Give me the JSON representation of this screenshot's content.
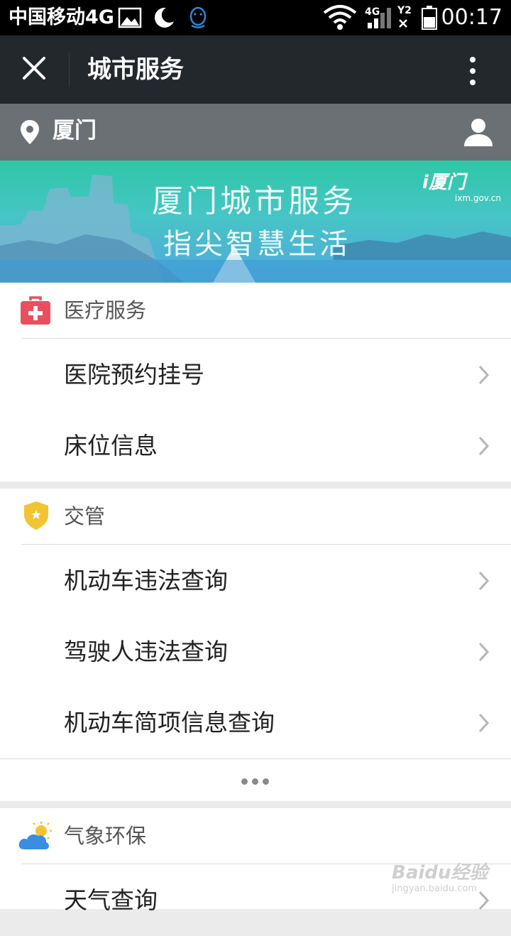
{
  "status_bar": {
    "carrier": "中国移动4G",
    "net_label": "4G",
    "sim_label": "Y2",
    "time": "00:17",
    "icons": [
      "image-icon",
      "moon-icon",
      "qq-icon",
      "wifi-icon",
      "signal-icon",
      "no-sim-icon",
      "battery-icon"
    ]
  },
  "action_bar": {
    "title": "城市服务",
    "close_icon": "close-icon",
    "more_icon": "more-vertical-icon"
  },
  "location_bar": {
    "city": "厦门",
    "pin_icon": "location-pin-icon",
    "user_icon": "user-icon"
  },
  "banner": {
    "line1": "厦门城市服务",
    "line2": "指尖智慧生活",
    "logo_text": "i厦门",
    "logo_url": "ixm.gov.cn"
  },
  "sections": [
    {
      "title": "医疗服务",
      "icon": "medical-kit-icon",
      "icon_color": "#e94f5e",
      "items": [
        "医院预约挂号",
        "床位信息"
      ]
    },
    {
      "title": "交管",
      "icon": "police-badge-icon",
      "icon_color": "#f2c431",
      "items": [
        "机动车违法查询",
        "驾驶人违法查询",
        "机动车简项信息查询"
      ],
      "more": "more-dots-icon"
    },
    {
      "title": "气象环保",
      "icon": "weather-icon",
      "icon_color": "#3a8ee0",
      "items": [
        "天气查询"
      ]
    }
  ],
  "watermark": {
    "text": "Baidu经验",
    "url": "jingyan.baidu.com"
  }
}
